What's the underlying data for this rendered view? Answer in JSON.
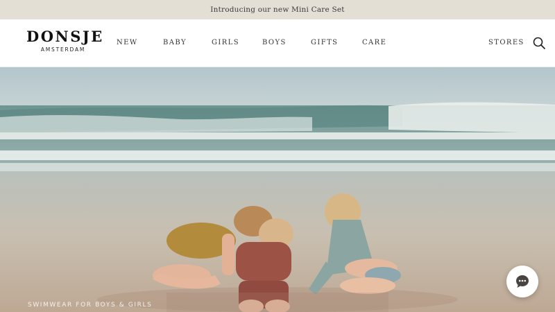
{
  "announcement": {
    "text": "Introducing our new Mini Care Set"
  },
  "logo": {
    "main": "DONSJE",
    "sub": "AMSTERDAM"
  },
  "nav": {
    "items": [
      {
        "label": "NEW"
      },
      {
        "label": "BABY"
      },
      {
        "label": "GIRLS"
      },
      {
        "label": "BOYS"
      },
      {
        "label": "GIFTS"
      },
      {
        "label": "CARE"
      }
    ],
    "stores": "STORES"
  },
  "icons": {
    "search": "search-icon",
    "chat": "chat-bubble-icon"
  },
  "hero": {
    "caption": "SWIMWEAR FOR BOYS & GIRLS"
  },
  "colors": {
    "announcement_bg": "#e4dfd4",
    "chat_icon": "#4a4441"
  }
}
